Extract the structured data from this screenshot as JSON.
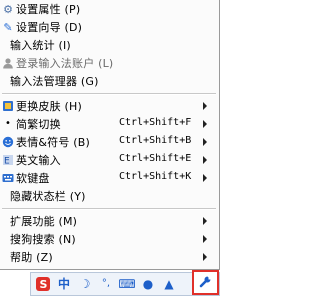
{
  "menu": {
    "items": [
      {
        "label": "设置属性 (P)",
        "icon": "gear-icon"
      },
      {
        "label": "设置向导 (D)",
        "icon": "wand-icon"
      },
      {
        "label": "输入统计 (I)",
        "icon": "none"
      },
      {
        "label": "登录输入法账户 (L)",
        "icon": "user-icon"
      },
      {
        "label": "输入法管理器 (G)",
        "icon": "none"
      },
      {
        "label": "更换皮肤 (H)",
        "icon": "skin-icon",
        "submenu": true
      },
      {
        "label": "简繁切换",
        "shortcut": "Ctrl+Shift+F",
        "icon": "none",
        "submenu": true
      },
      {
        "label": "表情&符号 (B)",
        "shortcut": "Ctrl+Shift+B",
        "icon": "smile-icon",
        "submenu": true
      },
      {
        "label": "英文输入",
        "shortcut": "Ctrl+Shift+E",
        "icon": "english-icon",
        "submenu": true
      },
      {
        "label": "软键盘",
        "shortcut": "Ctrl+Shift+K",
        "icon": "keyboard-icon",
        "submenu": true
      },
      {
        "label": "隐藏状态栏 (Y)",
        "icon": "none"
      },
      {
        "label": "扩展功能 (M)",
        "icon": "none",
        "submenu": true
      },
      {
        "label": "搜狗搜索 (N)",
        "icon": "none",
        "submenu": true
      },
      {
        "label": "帮助 (Z)",
        "icon": "none",
        "submenu": true
      }
    ]
  },
  "tray": {
    "items": [
      {
        "name": "sogou-logo-icon",
        "glyph": "S"
      },
      {
        "name": "chinese-mode-icon",
        "glyph": "中"
      },
      {
        "name": "moon-icon",
        "glyph": "☽"
      },
      {
        "name": "punctuation-icon",
        "glyph": "°,"
      },
      {
        "name": "keyboard-icon",
        "glyph": "⌨"
      },
      {
        "name": "user-icon",
        "glyph": "●"
      },
      {
        "name": "shirt-icon",
        "glyph": "▲"
      }
    ],
    "wrench_glyph": "🔧"
  },
  "colors": {
    "accent_red": "#e0302a",
    "icon_blue": "#2a6fd6",
    "tray_bg": "#eef3fa"
  }
}
